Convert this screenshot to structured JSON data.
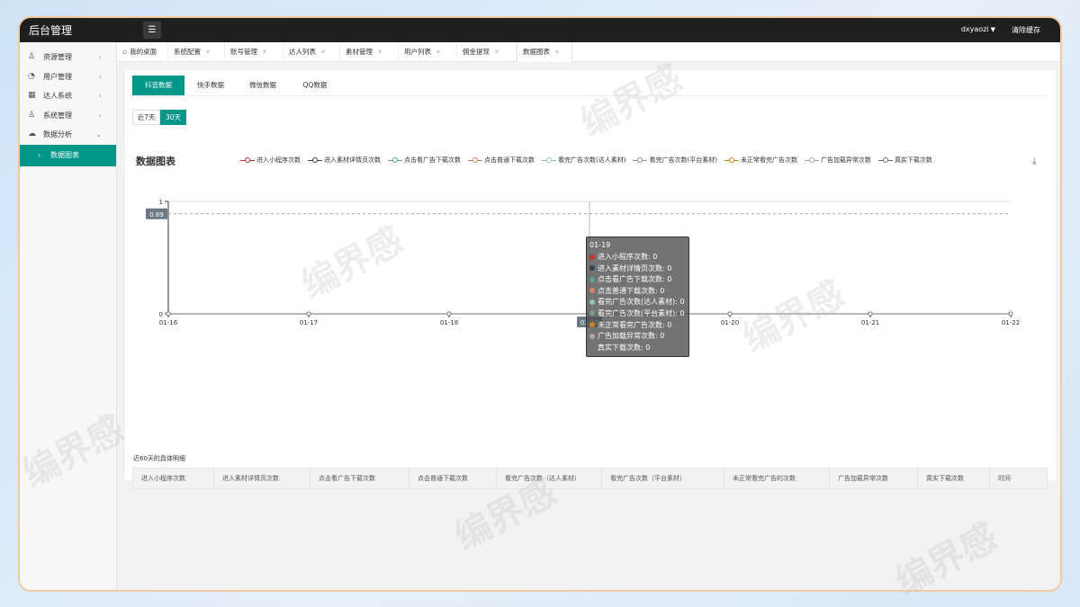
{
  "app": {
    "title": "后台管理"
  },
  "header": {
    "user": "dxyaozi",
    "clear_cache": "清除缓存"
  },
  "sidebar": {
    "items": [
      {
        "label": "资源管理"
      },
      {
        "label": "用户管理"
      },
      {
        "label": "达人系统"
      },
      {
        "label": "系统管理"
      },
      {
        "label": "数据分析"
      }
    ],
    "sub_item": "数据图表"
  },
  "page_tabs": [
    "我的桌面",
    "系统配置",
    "账号管理",
    "达人列表",
    "素材管理",
    "用户列表",
    "佣金提现",
    "数据图表"
  ],
  "platform_tabs": [
    "抖音数据",
    "快手数据",
    "微信数据",
    "QQ数据"
  ],
  "range_buttons": [
    "近7天",
    "30天"
  ],
  "chart_section_title": "数据图表",
  "watermark_text": "编界感",
  "chart_data": {
    "type": "line",
    "title": "数据图表",
    "categories": [
      "01-16",
      "01-17",
      "01-18",
      "01-19",
      "01-20",
      "01-21",
      "01-22"
    ],
    "series": [
      {
        "name": "进入小程序次数",
        "color": "#c23531",
        "values": [
          0,
          0,
          0,
          0,
          0,
          0,
          0
        ]
      },
      {
        "name": "进入素材详情页次数",
        "color": "#2f4554",
        "values": [
          0,
          0,
          0,
          0,
          0,
          0,
          0
        ]
      },
      {
        "name": "点击看广告下载次数",
        "color": "#61a0a8",
        "values": [
          0,
          0,
          0,
          0,
          0,
          0,
          0
        ]
      },
      {
        "name": "点击普通下载次数",
        "color": "#d48265",
        "values": [
          0,
          0,
          0,
          0,
          0,
          0,
          0
        ]
      },
      {
        "name": "看完广告次数(达人素材)",
        "color": "#91c7ae",
        "values": [
          0,
          0,
          0,
          0,
          0,
          0,
          0
        ]
      },
      {
        "name": "看完广告次数(平台素材)",
        "color": "#749f83",
        "values": [
          0,
          0,
          0,
          0,
          0,
          0,
          0
        ]
      },
      {
        "name": "未正常看完广告次数",
        "color": "#ca8622",
        "values": [
          0,
          0,
          0,
          0,
          0,
          0,
          0
        ]
      },
      {
        "name": "广告加载异常次数",
        "color": "#bda29a",
        "values": [
          0,
          0,
          0,
          0,
          0,
          0,
          0
        ]
      },
      {
        "name": "真实下载次数",
        "color": "#6e7074",
        "values": [
          0,
          0,
          0,
          0,
          0,
          0,
          0
        ]
      }
    ],
    "ylim": [
      0,
      1
    ],
    "yticks": [
      0,
      1
    ],
    "crosshair_value": 0.89,
    "highlighted_category": "01-19",
    "grid": false,
    "legend_position": "top"
  },
  "tooltip": {
    "title": "01-19",
    "rows": [
      {
        "label": "进入小程序次数: 0",
        "color": "#c23531"
      },
      {
        "label": "进入素材详情页次数: 0",
        "color": "#2f4554"
      },
      {
        "label": "点击看广告下载次数: 0",
        "color": "#61a0a8"
      },
      {
        "label": "点击普通下载次数: 0",
        "color": "#d48265"
      },
      {
        "label": "看完广告次数(达人素材): 0",
        "color": "#91c7ae"
      },
      {
        "label": "看完广告次数(平台素材): 0",
        "color": "#749f83"
      },
      {
        "label": "未正常看完广告次数: 0",
        "color": "#ca8622"
      },
      {
        "label": "广告加载异常次数: 0",
        "color": "#bda29a"
      },
      {
        "label": "真实下载次数: 0",
        "color": ""
      }
    ]
  },
  "details": {
    "title": "近60天的具体明细",
    "columns": [
      "进入小程序次数",
      "进入素材详情页次数",
      "点击看广告下载次数",
      "点击普通下载次数",
      "看完广告次数（达人素材）",
      "看完广告次数（平台素材）",
      "未正常看完广告的次数",
      "广告加载异常次数",
      "真实下载次数",
      "时间"
    ]
  }
}
